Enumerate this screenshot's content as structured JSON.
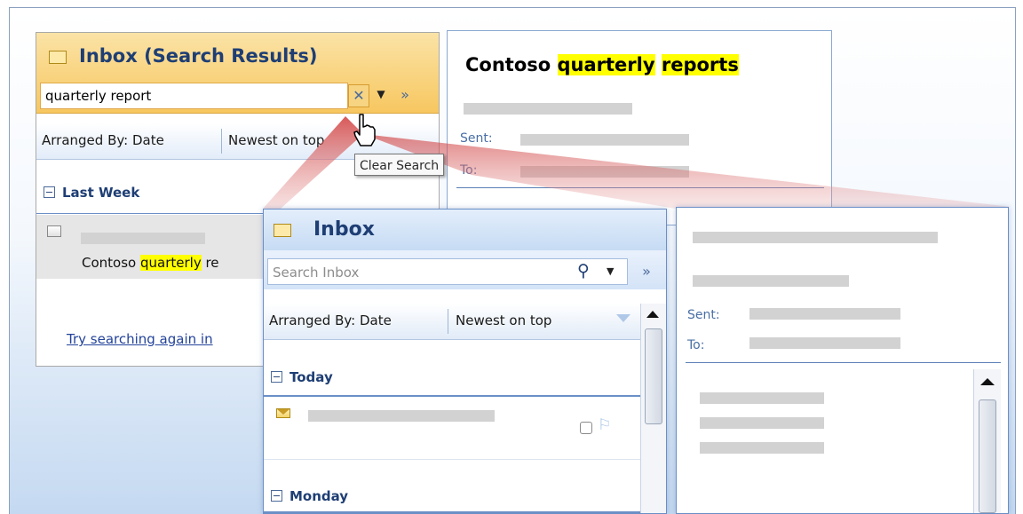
{
  "search_pane": {
    "title": "Inbox (Search Results)",
    "search_value": "quarterly report",
    "arranged_label": "Arranged By: Date",
    "sort_label": "Newest on top",
    "group_label": "Last Week",
    "item_subject_prefix": "Contoso ",
    "item_subject_highlight": "quarterly",
    "item_subject_suffix": " re",
    "try_link": "Try searching again in",
    "tooltip": "Clear Search"
  },
  "search_reading": {
    "title_prefix": "Contoso ",
    "title_hl1": "quarterly",
    "title_hl2": "reports",
    "sent_label": "Sent:",
    "to_label": "To:"
  },
  "inbox_pane": {
    "title": "Inbox",
    "search_placeholder": "Search Inbox",
    "arranged_label": "Arranged By: Date",
    "sort_label": "Newest on top",
    "group_today": "Today",
    "group_monday": "Monday"
  },
  "reading_pane": {
    "sent_label": "Sent:",
    "to_label": "To:"
  },
  "colors": {
    "accent_orange": "#f7c760",
    "accent_blue": "#c6dbf4",
    "highlight": "#ffff00",
    "funnel_red": "#d03a3a"
  }
}
